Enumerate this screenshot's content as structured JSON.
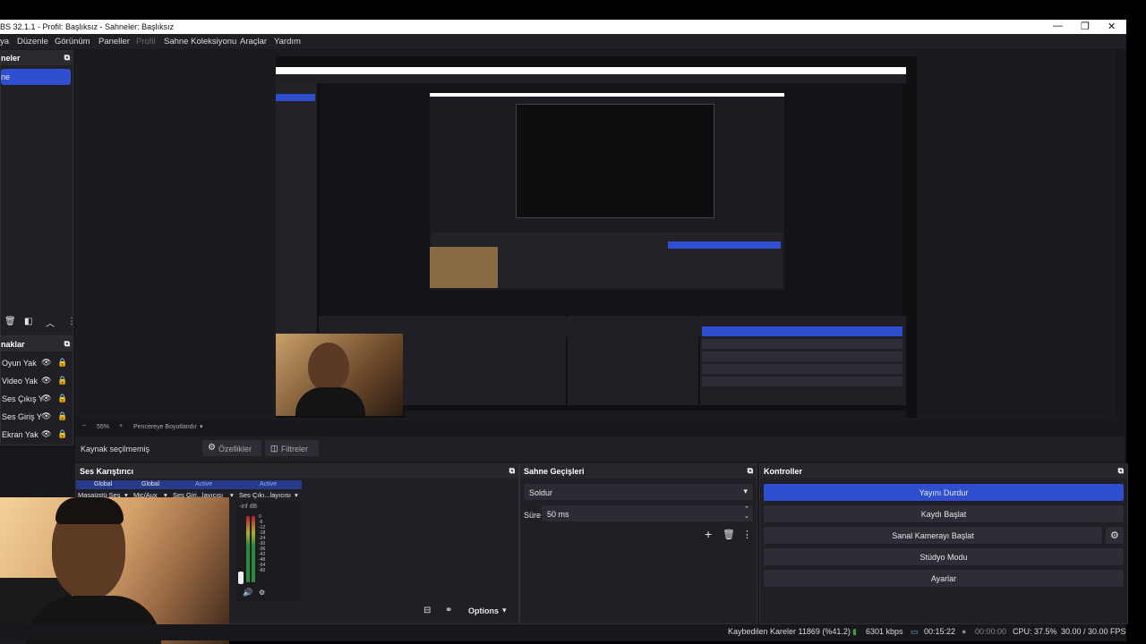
{
  "window": {
    "title": "BS 32.1.1 - Profil: Başlıksız - Sahneler: Başlıksız",
    "controls": [
      "—",
      "❐",
      "✕"
    ]
  },
  "menu": [
    "ya",
    "Düzenle",
    "Görünüm",
    "Paneller",
    "Profil",
    "Sahne Koleksiyonu",
    "Araçlar",
    "Yardım"
  ],
  "scenes": {
    "title": "neler",
    "items": [
      "ne"
    ]
  },
  "sources": {
    "title": "naklar",
    "items": [
      "Oyun Yak",
      "Video Yak",
      "Ses Çıkış Y",
      "Ses Giriş Y",
      "Ekran Yak"
    ]
  },
  "preview_bar": {
    "minus": "−",
    "zoom": "55%",
    "plus": "+",
    "fit": "Pencereye Boyutlandır"
  },
  "context_bar": {
    "no_source": "Kaynak seçilmemiş",
    "properties": "Özellikler",
    "filters": "Filtreler"
  },
  "mixer": {
    "title": "Ses Karıştırıcı",
    "tags": [
      "Global",
      "Global",
      "Active",
      "Active"
    ],
    "channels": [
      "Masaüstü Ses",
      "Mic/Aux",
      "Ses Giri...layıcısı",
      "Ses Çıkı...layıcısı"
    ],
    "db_label": "-inf dB",
    "scale": [
      "0",
      "-6",
      "-12",
      "-18",
      "-24",
      "-30",
      "-36",
      "-42",
      "-48",
      "-54",
      "-60"
    ],
    "options": "Options"
  },
  "transitions": {
    "title": "Sahne Geçişleri",
    "selected": "Soldur",
    "duration_label": "Süre",
    "duration_value": "50 ms"
  },
  "controls": {
    "title": "Kontroller",
    "buttons": [
      "Yayını Durdur",
      "Kaydı Başlat",
      "Sanal Kamerayı Başlat",
      "Stüdyo Modu",
      "Ayarlar"
    ]
  },
  "status": {
    "dropped": "Kaybedilen Kareler 11869 (%41.2)",
    "bitrate": "6301 kbps",
    "stream_time": "00:15:22",
    "rec_time": "00:00:00",
    "cpu": "CPU: 37.5%",
    "fps": "30.00 / 30.00 FPS"
  },
  "colors": {
    "accent": "#2f4fd0",
    "panel": "#1f1f25",
    "background": "#18181c"
  }
}
